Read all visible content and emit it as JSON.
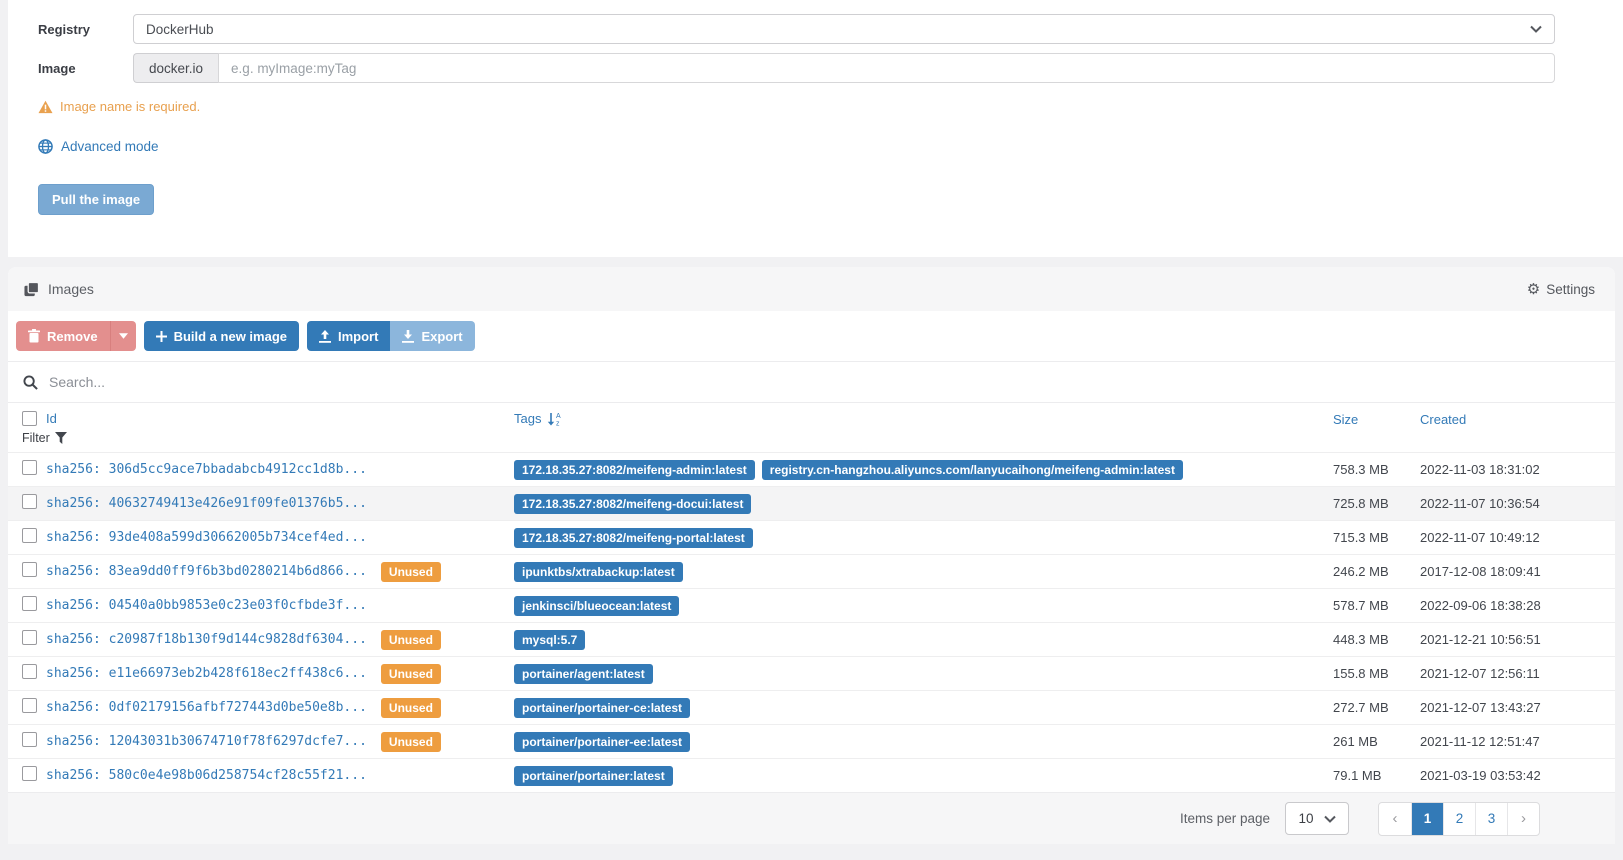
{
  "colors": {
    "accent": "#337ab7",
    "warning": "#ee9d3f",
    "warning-text": "#e8a04e",
    "danger": "#e38f8e"
  },
  "pull_form": {
    "registry_label": "Registry",
    "registry_value": "DockerHub",
    "image_label": "Image",
    "image_addon": "docker.io",
    "image_placeholder": "e.g. myImage:myTag",
    "warning_text": "Image name is required.",
    "advanced_mode_label": "Advanced mode",
    "pull_button_label": "Pull the image"
  },
  "panel": {
    "title": "Images",
    "settings_label": "Settings",
    "toolbar": {
      "remove_label": "Remove",
      "build_label": "Build a new image",
      "import_label": "Import",
      "export_label": "Export"
    },
    "search_placeholder": "Search..."
  },
  "table": {
    "headers": {
      "id": "Id",
      "filter": "Filter",
      "tags": "Tags",
      "size": "Size",
      "created": "Created"
    },
    "unused_label": "Unused",
    "rows": [
      {
        "id": "sha256: 306d5cc9ace7bbadabcb4912cc1d8b...",
        "unused": false,
        "highlighted": false,
        "tags": [
          "172.18.35.27:8082/meifeng-admin:latest",
          "registry.cn-hangzhou.aliyuncs.com/lanyucaihong/meifeng-admin:latest"
        ],
        "size": "758.3 MB",
        "created": "2022-11-03 18:31:02"
      },
      {
        "id": "sha256: 40632749413e426e91f09fe01376b5...",
        "unused": false,
        "highlighted": true,
        "tags": [
          "172.18.35.27:8082/meifeng-docui:latest"
        ],
        "size": "725.8 MB",
        "created": "2022-11-07 10:36:54"
      },
      {
        "id": "sha256: 93de408a599d30662005b734cef4ed...",
        "unused": false,
        "highlighted": false,
        "tags": [
          "172.18.35.27:8082/meifeng-portal:latest"
        ],
        "size": "715.3 MB",
        "created": "2022-11-07 10:49:12"
      },
      {
        "id": "sha256: 83ea9dd0ff9f6b3bd0280214b6d866...",
        "unused": true,
        "highlighted": false,
        "tags": [
          "ipunktbs/xtrabackup:latest"
        ],
        "size": "246.2 MB",
        "created": "2017-12-08 18:09:41"
      },
      {
        "id": "sha256: 04540a0bb9853e0c23e03f0cfbde3f...",
        "unused": false,
        "highlighted": false,
        "tags": [
          "jenkinsci/blueocean:latest"
        ],
        "size": "578.7 MB",
        "created": "2022-09-06 18:38:28"
      },
      {
        "id": "sha256: c20987f18b130f9d144c9828df6304...",
        "unused": true,
        "highlighted": false,
        "tags": [
          "mysql:5.7"
        ],
        "size": "448.3 MB",
        "created": "2021-12-21 10:56:51"
      },
      {
        "id": "sha256: e11e66973eb2b428f618ec2ff438c6...",
        "unused": true,
        "highlighted": false,
        "tags": [
          "portainer/agent:latest"
        ],
        "size": "155.8 MB",
        "created": "2021-12-07 12:56:11"
      },
      {
        "id": "sha256: 0df02179156afbf727443d0be50e8b...",
        "unused": true,
        "highlighted": false,
        "tags": [
          "portainer/portainer-ce:latest"
        ],
        "size": "272.7 MB",
        "created": "2021-12-07 13:43:27"
      },
      {
        "id": "sha256: 12043031b30674710f78f6297dcfe7...",
        "unused": true,
        "highlighted": false,
        "tags": [
          "portainer/portainer-ee:latest"
        ],
        "size": "261 MB",
        "created": "2021-11-12 12:51:47"
      },
      {
        "id": "sha256: 580c0e4e98b06d258754cf28c55f21...",
        "unused": false,
        "highlighted": false,
        "tags": [
          "portainer/portainer:latest"
        ],
        "size": "79.1 MB",
        "created": "2021-03-19 03:53:42"
      }
    ]
  },
  "footer": {
    "items_per_page_label": "Items per page",
    "items_per_page_value": "10",
    "prev": "‹",
    "next": "›",
    "pages": [
      "1",
      "2",
      "3"
    ],
    "active_page": "1"
  }
}
